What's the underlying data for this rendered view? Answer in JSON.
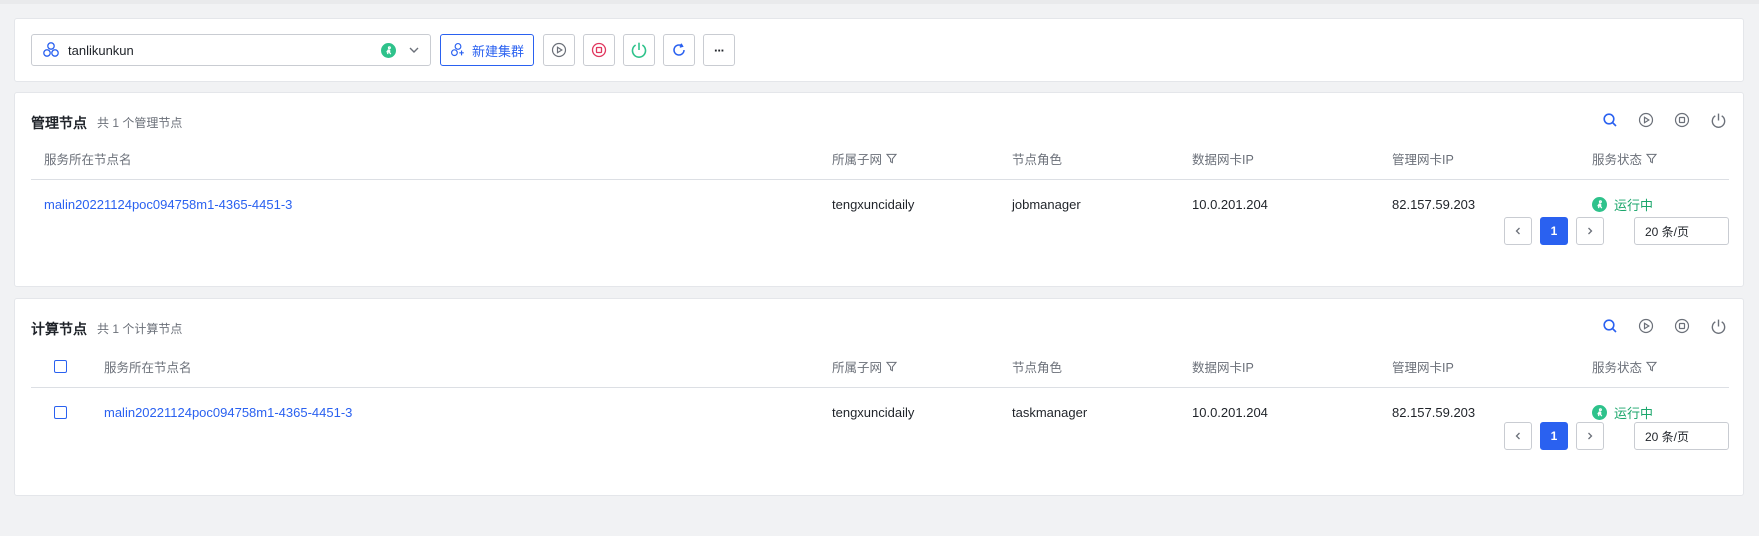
{
  "toolbar": {
    "cluster_name": "tanlikunkun",
    "new_cluster_label": "新建集群",
    "more_label": "···"
  },
  "mgmt": {
    "title": "管理节点",
    "summary": "共 1 个管理节点",
    "columns": [
      "服务所在节点名",
      "所属子网",
      "节点角色",
      "数据网卡IP",
      "管理网卡IP",
      "服务状态"
    ],
    "rows": [
      {
        "node": "malin20221124poc094758m1-4365-4451-3",
        "subnet": "tengxuncidaily",
        "role": "jobmanager",
        "data_ip": "10.0.201.204",
        "mgmt_ip": "82.157.59.203",
        "status": "运行中"
      }
    ],
    "page": "1",
    "page_size": "20 条/页"
  },
  "comp": {
    "title": "计算节点",
    "summary": "共 1 个计算节点",
    "columns": [
      "服务所在节点名",
      "所属子网",
      "节点角色",
      "数据网卡IP",
      "管理网卡IP",
      "服务状态"
    ],
    "rows": [
      {
        "node": "malin20221124poc094758m1-4365-4451-3",
        "subnet": "tengxuncidaily",
        "role": "taskmanager",
        "data_ip": "10.0.201.204",
        "mgmt_ip": "82.157.59.203",
        "status": "运行中"
      }
    ],
    "page": "1",
    "page_size": "20 条/页"
  },
  "colors": {
    "primary": "#2a61f0",
    "running": "#1aa66b",
    "stop": "#e0365e",
    "power": "#2ec28b"
  },
  "icons": [
    "cluster-icon",
    "status-running-icon",
    "chevron-down-icon",
    "play-icon",
    "stop-icon",
    "power-icon",
    "refresh-icon",
    "search-icon",
    "filter-icon",
    "chevron-left-icon",
    "chevron-right-icon"
  ]
}
